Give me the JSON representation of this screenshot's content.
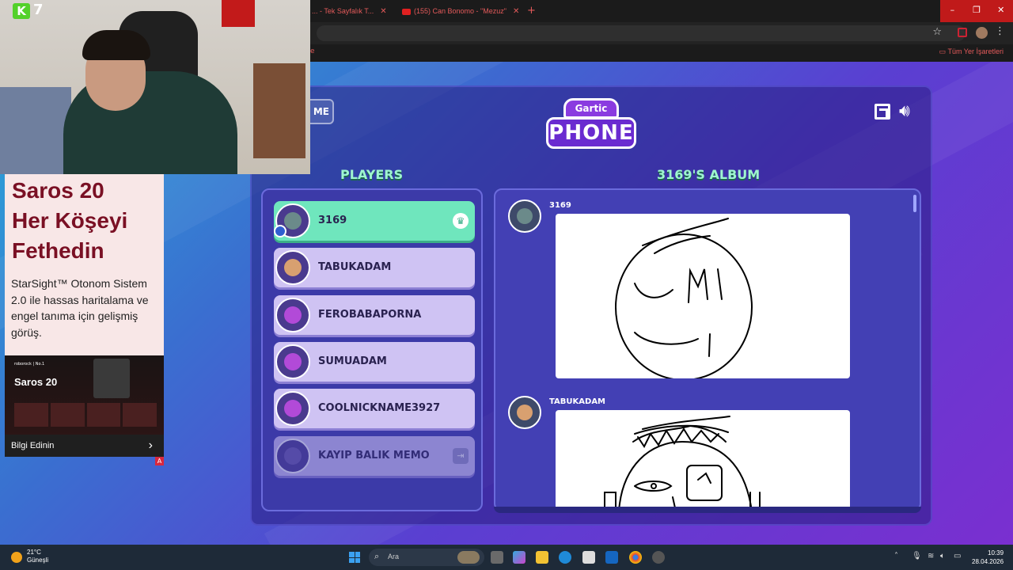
{
  "browser": {
    "tabs": [
      {
        "title": "... - Tek Sayfalık T..."
      },
      {
        "title": "(155) Can Bonomo - \"Mezuz\""
      }
    ],
    "new_tab": "+",
    "window_controls": {
      "minimize": "–",
      "restore": "❐",
      "close": "✕"
    },
    "bookmarks_right": "Tüm Yer İşaretleri",
    "bookmarks_left": "e"
  },
  "stream_overlay": {
    "k_badge": "K",
    "k_count": "7"
  },
  "ad": {
    "title": "Saros 20\nHer Köşeyi\nFethedin",
    "body": "StarSight™ Otonom Sistem 2.0 ile hassas haritalama ve engel tanıma için gelişmiş görüş.",
    "image_title": "Saros 20",
    "image_brand": "roborock  |  No.1",
    "cta": "Bilgi Edinin",
    "choice": "A"
  },
  "game": {
    "home_button": "ME",
    "logo_top": "Gartic",
    "logo_bottom": "PHONE",
    "players_title": "PLAYERS",
    "album_title": "3169'S ALBUM",
    "players": [
      {
        "name": "3169",
        "state": "host",
        "face_color": "#6b8a8a"
      },
      {
        "name": "TABUKADAM",
        "state": "normal",
        "face_color": "#d8a070"
      },
      {
        "name": "FEROBABAPORNA",
        "state": "normal",
        "face_color": "#b24ad8"
      },
      {
        "name": "SUMUADAM",
        "state": "normal",
        "face_color": "#b24ad8"
      },
      {
        "name": "COOLNICKNAME3927",
        "state": "normal",
        "face_color": "#b24ad8"
      },
      {
        "name": "KAYIP BALIK MEMO",
        "state": "left",
        "face_color": "#6a5aa8"
      }
    ],
    "album_entries": [
      {
        "author": "3169",
        "face_color": "#6b8a8a"
      },
      {
        "author": "TABUKADAM",
        "face_color": "#d8a070"
      }
    ]
  },
  "taskbar": {
    "weather_temp": "21°C",
    "weather_desc": "Güneşli",
    "search_placeholder": "Ara",
    "time": "10:39",
    "date": "28.04.2026"
  }
}
